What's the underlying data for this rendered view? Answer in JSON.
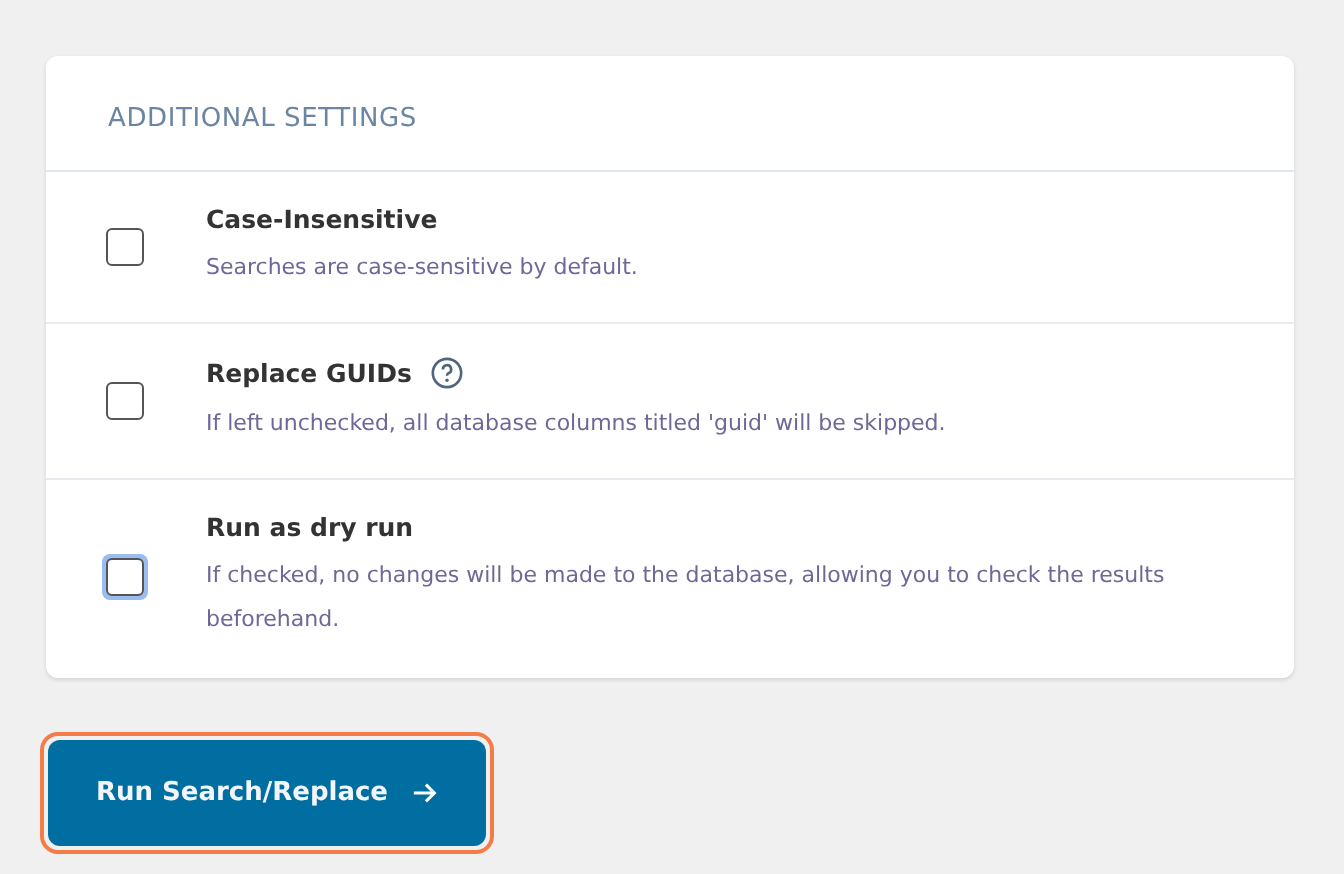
{
  "settings": {
    "title": "ADDITIONAL SETTINGS",
    "options": [
      {
        "label": "Case-Insensitive",
        "description": "Searches are case-sensitive by default.",
        "checked": false,
        "focused": false,
        "help": false
      },
      {
        "label": "Replace GUIDs",
        "description": "If left unchecked, all database columns titled 'guid' will be skipped.",
        "checked": false,
        "focused": false,
        "help": true
      },
      {
        "label": "Run as dry run",
        "description": "If checked, no changes will be made to the database, allowing you to check the results beforehand.",
        "checked": false,
        "focused": true,
        "help": false
      }
    ]
  },
  "submit": {
    "label": "Run Search/Replace",
    "focused": true
  }
}
